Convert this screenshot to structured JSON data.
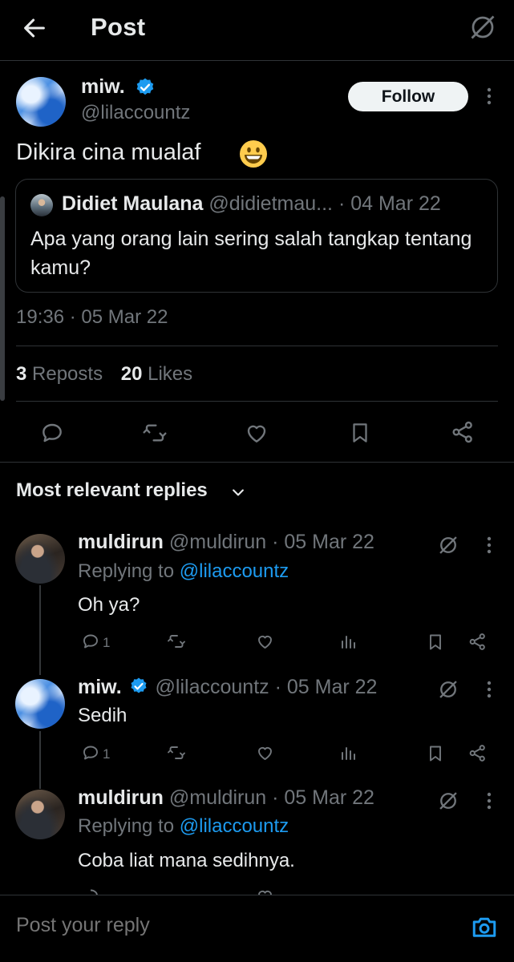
{
  "header": {
    "title": "Post",
    "back_icon": "back-arrow-icon",
    "grok_icon": "grok-icon"
  },
  "post": {
    "author_name": "miw.",
    "author_handle": "@lilaccountz",
    "follow_label": "Follow",
    "text": "Dikira cina mualaf",
    "emoji": "grinning-face-emoji",
    "quote": {
      "name": "Didiet Maulana",
      "handle": "@didietmau...",
      "date": "· 04 Mar 22",
      "text": "Apa yang orang lain sering salah tangkap tentang kamu?"
    },
    "timestamp": "19:36 · 05 Mar 22",
    "reposts_count": "3",
    "reposts_label": "Reposts",
    "likes_count": "20",
    "likes_label": "Likes"
  },
  "replies_header": "Most relevant replies",
  "replies": [
    {
      "name": "muldirun",
      "handle": "@muldirun",
      "date": "· 05 Mar 22",
      "replying_prefix": "Replying to",
      "replying_to": "@lilaccountz",
      "text": "Oh ya?",
      "reply_count": "1"
    },
    {
      "name": "miw.",
      "handle": "@lilaccountz",
      "date": "· 05 Mar 22",
      "text": "Sedih",
      "reply_count": "1"
    },
    {
      "name": "muldirun",
      "handle": "@muldirun",
      "date": "· 05 Mar 22",
      "replying_prefix": "Replying to",
      "replying_to": "@lilaccountz",
      "text": "Coba liat mana sedihnya."
    }
  ],
  "composer": {
    "placeholder": "Post your reply"
  },
  "colors": {
    "background": "#000000",
    "accent": "#1d9bf0",
    "text": "#e7e9ea",
    "muted": "#71767b",
    "divider": "#2f3336"
  }
}
